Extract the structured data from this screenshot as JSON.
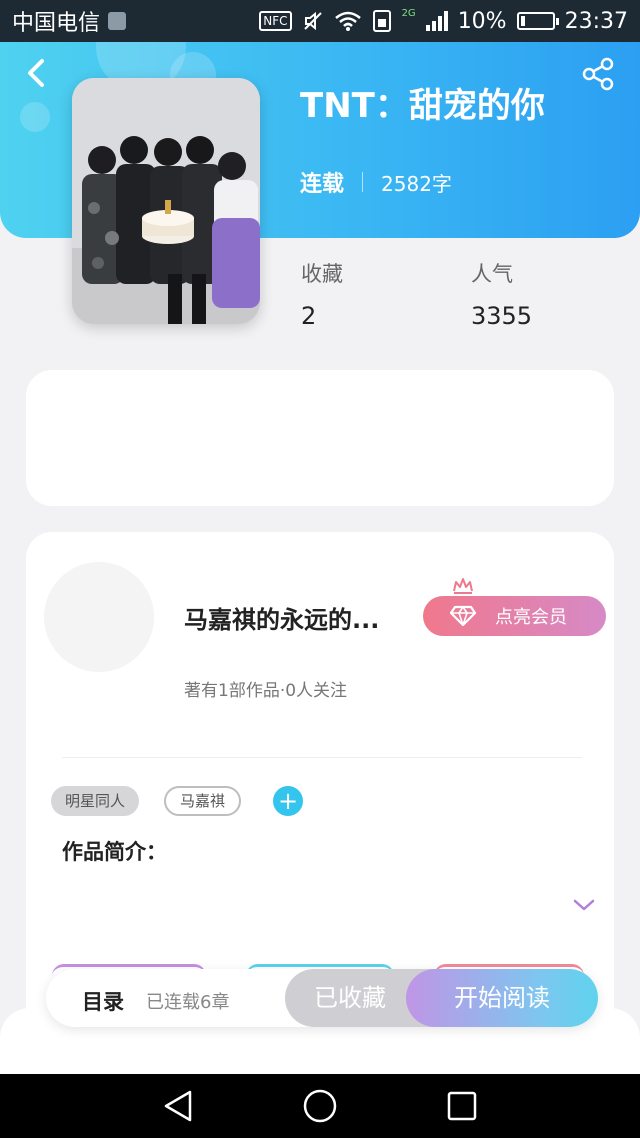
{
  "status_bar": {
    "carrier": "中国电信",
    "nfc": "NFC",
    "network": "2G",
    "battery": "10%",
    "time": "23:37"
  },
  "book": {
    "title": "TNT：甜宠的你",
    "status": "连载",
    "word_count": "2582字",
    "favorites_label": "收藏",
    "favorites_value": "2",
    "popularity_label": "人气",
    "popularity_value": "3355"
  },
  "author": {
    "name": "马嘉祺的永远的...",
    "meta": "著有1部作品·0人关注",
    "vip_button": "点亮会员"
  },
  "tags": [
    "明星同人",
    "马嘉祺"
  ],
  "add_tag": "+",
  "intro": {
    "label": "作品简介："
  },
  "action_bar": {
    "toc_label": "目录",
    "toc_count": "已连载6章",
    "favorite_button": "已收藏",
    "read_button": "开始阅读"
  },
  "icons": {
    "back": "back-arrow-icon",
    "share": "share-icon",
    "expand": "chevron-down-icon",
    "vip": "diamond-icon",
    "crown": "crown-icon"
  },
  "colors": {
    "header_start": "#4fd2f0",
    "header_end": "#2c9ff2",
    "vip_start": "#f0788c",
    "vip_end": "#d68ac7",
    "accent_cyan": "#33c5ee",
    "read_start": "#c095e6",
    "read_end": "#5fd3ee"
  }
}
